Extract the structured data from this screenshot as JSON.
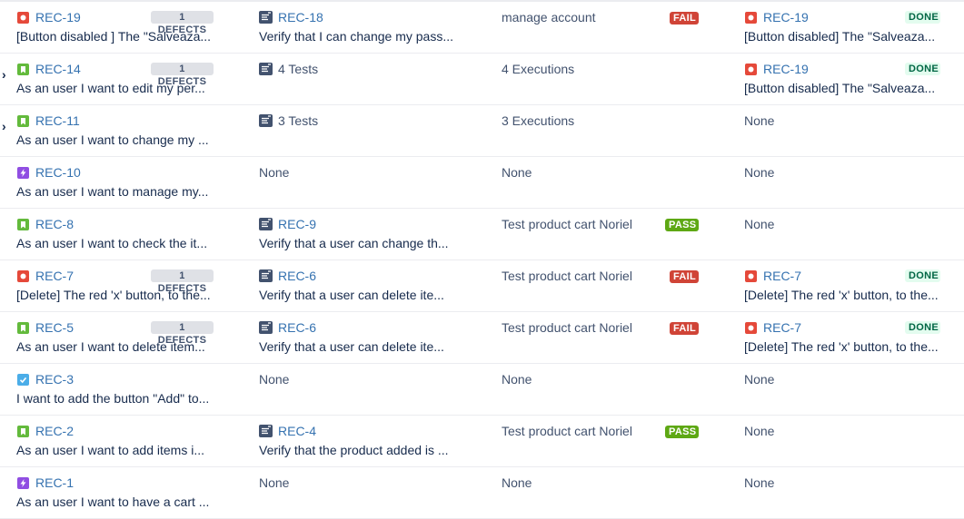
{
  "colors": {
    "bug": "#e5493a",
    "story": "#63ba3c",
    "epic": "#904ee2",
    "task": "#4bade8",
    "fail": "#d04437",
    "pass": "#5ea814",
    "done_bg": "#e3fcef",
    "link": "#3572b0"
  },
  "rows": [
    {
      "expandable": false,
      "req": {
        "type": "bug",
        "icon": "bug-icon",
        "key": "REC-19",
        "summary": "[Button disabled ] The \"Salveaza...",
        "defects": "1 DEFECTS"
      },
      "tests": {
        "icon": "test-icon",
        "text": "REC-18",
        "is_link": true,
        "summary": "Verify that I can change my pass..."
      },
      "execution": {
        "text": "manage account",
        "status": "FAIL"
      },
      "defect": {
        "icon": "bug-icon",
        "key": "REC-19",
        "summary": "[Button disabled] The \"Salveaza...",
        "status": "DONE"
      }
    },
    {
      "expandable": true,
      "req": {
        "type": "story",
        "icon": "story-icon",
        "key": "REC-14",
        "summary": "As an user I want to edit my per...",
        "defects": "1 DEFECTS"
      },
      "tests": {
        "icon": "test-icon",
        "text": "4 Tests",
        "is_link": false,
        "summary": ""
      },
      "execution": {
        "text": "4 Executions",
        "status": ""
      },
      "defect": {
        "icon": "bug-icon",
        "key": "REC-19",
        "summary": "[Button disabled] The \"Salveaza...",
        "status": "DONE"
      }
    },
    {
      "expandable": true,
      "req": {
        "type": "story",
        "icon": "story-icon",
        "key": "REC-11",
        "summary": "As an user I want to change my ...",
        "defects": ""
      },
      "tests": {
        "icon": "test-icon",
        "text": "3 Tests",
        "is_link": false,
        "summary": ""
      },
      "execution": {
        "text": "3 Executions",
        "status": ""
      },
      "defect": {
        "none": "None"
      }
    },
    {
      "expandable": false,
      "req": {
        "type": "epic",
        "icon": "epic-icon",
        "key": "REC-10",
        "summary": "As an user I want to manage my...",
        "defects": ""
      },
      "tests": {
        "none": "None"
      },
      "execution": {
        "text": "None",
        "status": ""
      },
      "defect": {
        "none": "None"
      }
    },
    {
      "expandable": false,
      "req": {
        "type": "story",
        "icon": "story-icon",
        "key": "REC-8",
        "summary": "As an user I want to check the it...",
        "defects": ""
      },
      "tests": {
        "icon": "test-icon",
        "text": "REC-9",
        "is_link": true,
        "summary": "Verify that a user can change th..."
      },
      "execution": {
        "text": "Test product cart Noriel",
        "status": "PASS"
      },
      "defect": {
        "none": "None"
      }
    },
    {
      "expandable": false,
      "req": {
        "type": "bug",
        "icon": "bug-icon",
        "key": "REC-7",
        "summary": "[Delete] The red 'x' button, to the...",
        "defects": "1 DEFECTS"
      },
      "tests": {
        "icon": "test-icon",
        "text": "REC-6",
        "is_link": true,
        "summary": "Verify that a user can delete ite..."
      },
      "execution": {
        "text": "Test product cart Noriel",
        "status": "FAIL"
      },
      "defect": {
        "icon": "bug-icon",
        "key": "REC-7",
        "summary": "[Delete] The red 'x' button, to the...",
        "status": "DONE"
      }
    },
    {
      "expandable": false,
      "req": {
        "type": "story",
        "icon": "story-icon",
        "key": "REC-5",
        "summary": "As an user I want to delete item...",
        "defects": "1 DEFECTS"
      },
      "tests": {
        "icon": "test-icon",
        "text": "REC-6",
        "is_link": true,
        "summary": "Verify that a user can delete ite..."
      },
      "execution": {
        "text": "Test product cart Noriel",
        "status": "FAIL"
      },
      "defect": {
        "icon": "bug-icon",
        "key": "REC-7",
        "summary": "[Delete] The red 'x' button, to the...",
        "status": "DONE"
      }
    },
    {
      "expandable": false,
      "req": {
        "type": "task",
        "icon": "task-icon",
        "key": "REC-3",
        "summary": "I want to add the button \"Add\" to...",
        "defects": ""
      },
      "tests": {
        "none": "None"
      },
      "execution": {
        "text": "None",
        "status": ""
      },
      "defect": {
        "none": "None"
      }
    },
    {
      "expandable": false,
      "req": {
        "type": "story",
        "icon": "story-icon",
        "key": "REC-2",
        "summary": "As an user I want to add items i...",
        "defects": ""
      },
      "tests": {
        "icon": "test-icon",
        "text": "REC-4",
        "is_link": true,
        "summary": "Verify that the product added is ..."
      },
      "execution": {
        "text": "Test product cart Noriel",
        "status": "PASS"
      },
      "defect": {
        "none": "None"
      }
    },
    {
      "expandable": false,
      "req": {
        "type": "epic",
        "icon": "epic-icon",
        "key": "REC-1",
        "summary": "As an user I want to have a cart ...",
        "defects": ""
      },
      "tests": {
        "none": "None"
      },
      "execution": {
        "text": "None",
        "status": ""
      },
      "defect": {
        "none": "None"
      }
    }
  ]
}
